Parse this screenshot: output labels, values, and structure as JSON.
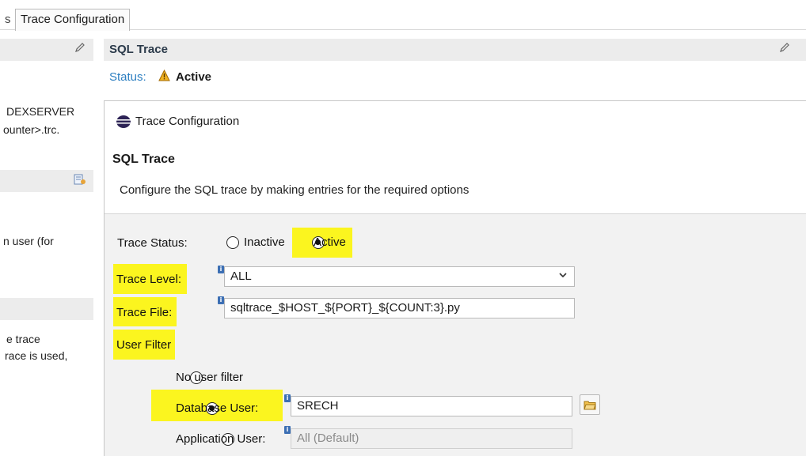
{
  "tabs": {
    "cut_tab": "s",
    "active_tab": "Trace Configuration"
  },
  "background": {
    "sql_trace_title": "SQL Trace",
    "status_label": "Status:",
    "status_value": "Active",
    "left_text_1a": "DEXSERVER",
    "left_text_1b": "ounter>.trc.",
    "left_text_2": "n user (for",
    "left_text_3a": "e trace",
    "left_text_3b": "race is used,"
  },
  "dialog": {
    "title": "Trace Configuration",
    "header_title": "SQL Trace",
    "header_description": "Configure the SQL trace by making entries for the required options",
    "trace_status_label": "Trace Status:",
    "status_options": {
      "inactive": "Inactive",
      "active": "Active",
      "selected": "active"
    },
    "trace_level_label": "Trace Level:",
    "trace_level_value": "ALL",
    "trace_file_label": "Trace File:",
    "trace_file_value": "sqltrace_$HOST_${PORT}_${COUNT:3}.py",
    "user_filter_label": "User Filter",
    "user_filter_options": {
      "none": "No user filter",
      "database_user": "Database User:",
      "application_user": "Application User:",
      "selected": "database_user"
    },
    "database_user_value": "SRECH",
    "application_user_value": "All (Default)"
  },
  "colors": {
    "highlight": "#fbf51f",
    "status_label": "#2d7fc1",
    "section_bg": "#ececec"
  },
  "icons": [
    "pencil-icon",
    "warning-icon",
    "app-logo-icon",
    "info-icon",
    "chevron-down-icon",
    "folder-browse-icon",
    "settings-icon"
  ]
}
